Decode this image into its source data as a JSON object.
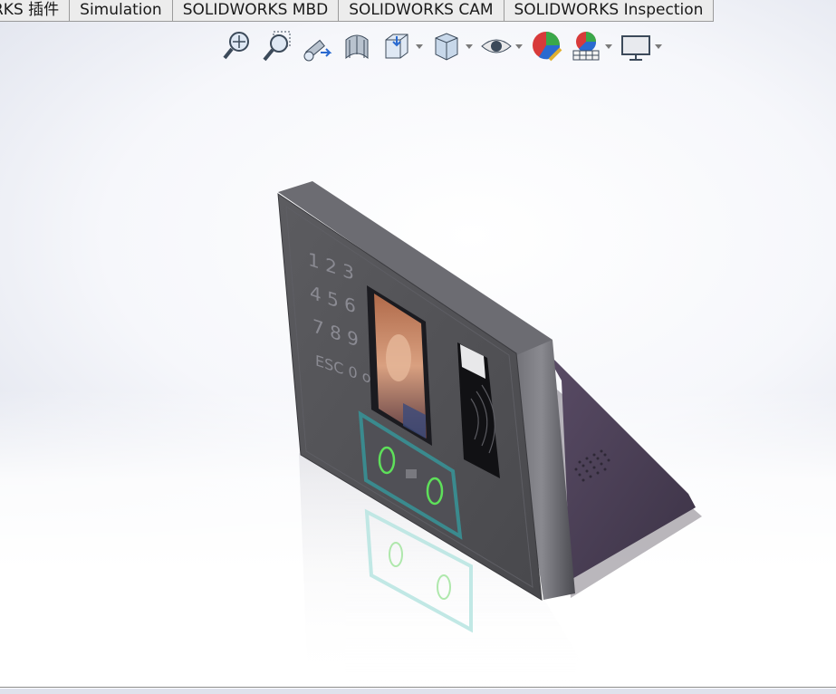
{
  "tabs": [
    {
      "label": "RKS 插件"
    },
    {
      "label": "Simulation"
    },
    {
      "label": "SOLIDWORKS MBD"
    },
    {
      "label": "SOLIDWORKS CAM"
    },
    {
      "label": "SOLIDWORKS Inspection"
    }
  ],
  "toolbar": {
    "icons": [
      "zoom-to-fit-icon",
      "zoom-to-area-icon",
      "previous-view-icon",
      "section-view-icon",
      "view-orientation-icon",
      "display-style-icon",
      "hide-show-items-icon",
      "edit-appearance-icon",
      "apply-scene-icon",
      "view-settings-icon"
    ]
  },
  "colors": {
    "accent": "#3a8a8e",
    "housing": "#4e4d52",
    "back": "#4a3f55"
  }
}
